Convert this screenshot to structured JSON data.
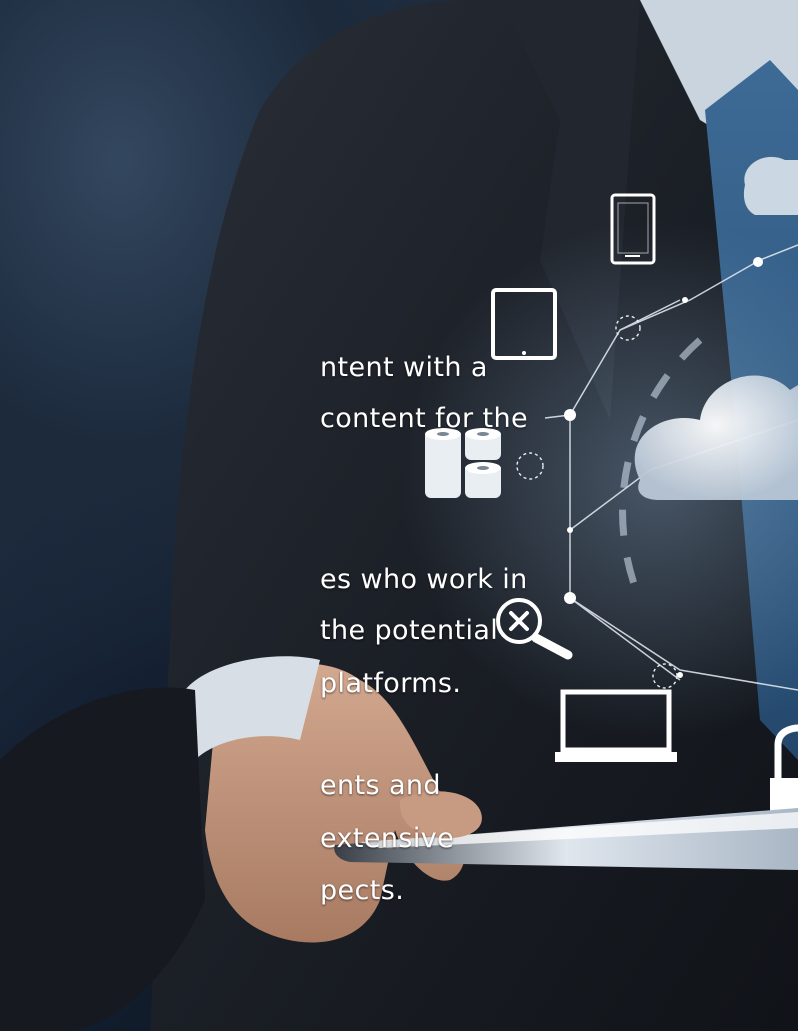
{
  "colors": {
    "background_top": "#2a3a50",
    "background_bottom": "#0b121d",
    "suit": "#1a1f26",
    "text": "#ffffff",
    "accent_line": "#e8eef5"
  },
  "slide_text": {
    "lines": [
      "ntent with a",
      "content for the",
      "es who work in",
      "the potential",
      "platforms.",
      "ents and",
      "extensive",
      "pects."
    ]
  },
  "icons": [
    "phone-icon",
    "tablet-icon",
    "database-icon",
    "cloud-icon",
    "search-remove-icon",
    "laptop-icon",
    "lock-icon"
  ]
}
